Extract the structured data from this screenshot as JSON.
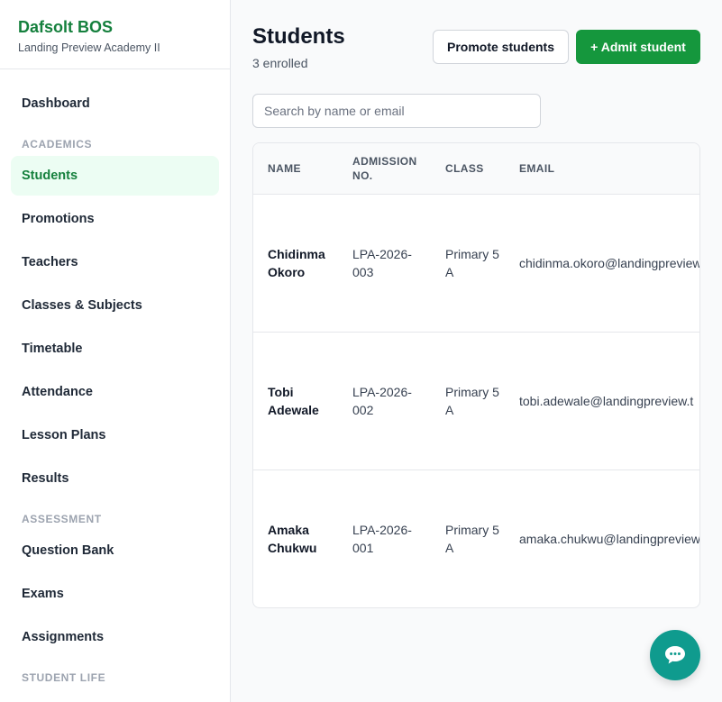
{
  "brand": {
    "name": "Dafsolt BOS",
    "school": "Landing Preview Academy II"
  },
  "sidebar": {
    "dashboard": "Dashboard",
    "section_academics": "ACADEMICS",
    "students": "Students",
    "promotions": "Promotions",
    "teachers": "Teachers",
    "classes_subjects": "Classes & Subjects",
    "timetable": "Timetable",
    "attendance": "Attendance",
    "lesson_plans": "Lesson Plans",
    "results": "Results",
    "section_assessment": "ASSESSMENT",
    "question_bank": "Question Bank",
    "exams": "Exams",
    "assignments": "Assignments",
    "section_student_life": "STUDENT LIFE",
    "active_item": "Students"
  },
  "page": {
    "title": "Students",
    "subtitle": "3 enrolled",
    "promote_label": "Promote students",
    "admit_label": "+ Admit student"
  },
  "search": {
    "placeholder": "Search by name or email",
    "value": ""
  },
  "table": {
    "headers": {
      "name": "NAME",
      "admission": "ADMISSION NO.",
      "class": "CLASS",
      "email": "EMAIL"
    },
    "rows": [
      {
        "name": "Chidinma Okoro",
        "admission": "LPA-2026-003",
        "class": "Primary 5 A",
        "email": "chidinma.okoro@landingpreview"
      },
      {
        "name": "Tobi Adewale",
        "admission": "LPA-2026-002",
        "class": "Primary 5 A",
        "email": "tobi.adewale@landingpreview.t"
      },
      {
        "name": "Amaka Chukwu",
        "admission": "LPA-2026-001",
        "class": "Primary 5 A",
        "email": "amaka.chukwu@landingpreview"
      }
    ]
  },
  "chat": {
    "icon": "chat-bubble-icon"
  },
  "colors": {
    "accent": "#15973d",
    "brand": "#15803d",
    "active_bg": "#ecfdf3",
    "chat": "#0f9b8e"
  }
}
